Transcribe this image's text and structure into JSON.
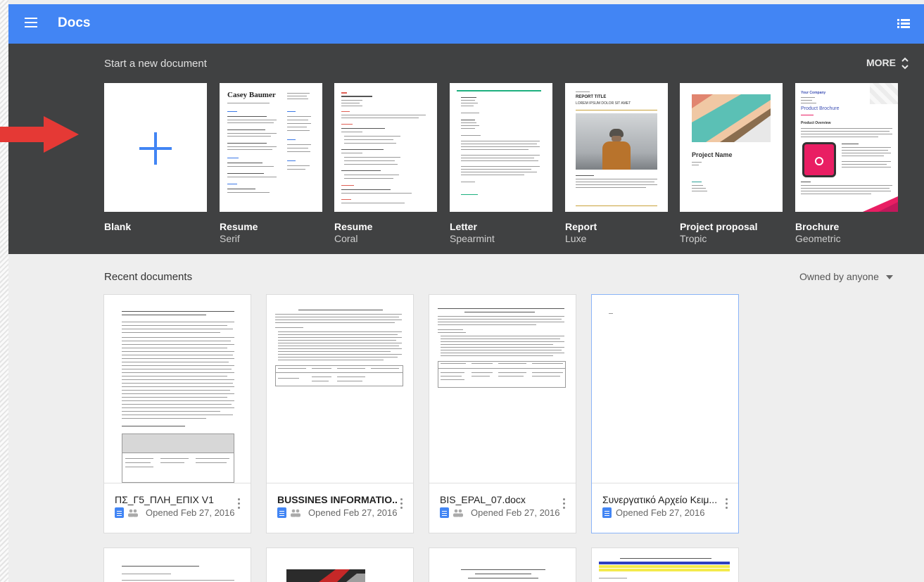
{
  "app": {
    "title": "Docs"
  },
  "templates": {
    "header": "Start a new document",
    "more_label": "MORE",
    "items": [
      {
        "name": "Blank",
        "sub": ""
      },
      {
        "name": "Resume",
        "sub": "Serif",
        "thumb_title": "Casey Baumer"
      },
      {
        "name": "Resume",
        "sub": "Coral"
      },
      {
        "name": "Letter",
        "sub": "Spearmint"
      },
      {
        "name": "Report",
        "sub": "Luxe",
        "thumb_title": "REPORT TITLE",
        "thumb_subtitle": "LOREM IPSUM DOLOR SIT AMET"
      },
      {
        "name": "Project proposal",
        "sub": "Tropic",
        "thumb_title": "Project Name"
      },
      {
        "name": "Brochure",
        "sub": "Geometric",
        "thumb_company": "Your Company",
        "thumb_title": "Product Brochure",
        "thumb_section": "Product Overview"
      }
    ]
  },
  "recent": {
    "header": "Recent documents",
    "owner_filter": "Owned by anyone",
    "docs": [
      {
        "name": "ΠΣ_Γ5_ΠΛΗ_ΕΠΙΧ V1",
        "opened": "Opened Feb 27, 2016",
        "shared": true
      },
      {
        "name": "BUSSINES INFORMATIO...",
        "opened": "Opened Feb 27, 2016",
        "shared": true
      },
      {
        "name": "BIS_EPAL_07.docx",
        "opened": "Opened Feb 27, 2016",
        "shared": true
      },
      {
        "name": "Συνεργατικό Αρχείο Κειμ...",
        "opened": "Opened Feb 27, 2016",
        "shared": false
      }
    ]
  },
  "colors": {
    "header_blue": "#4285f4",
    "template_bg": "#404142",
    "arrow_red": "#e53935"
  }
}
